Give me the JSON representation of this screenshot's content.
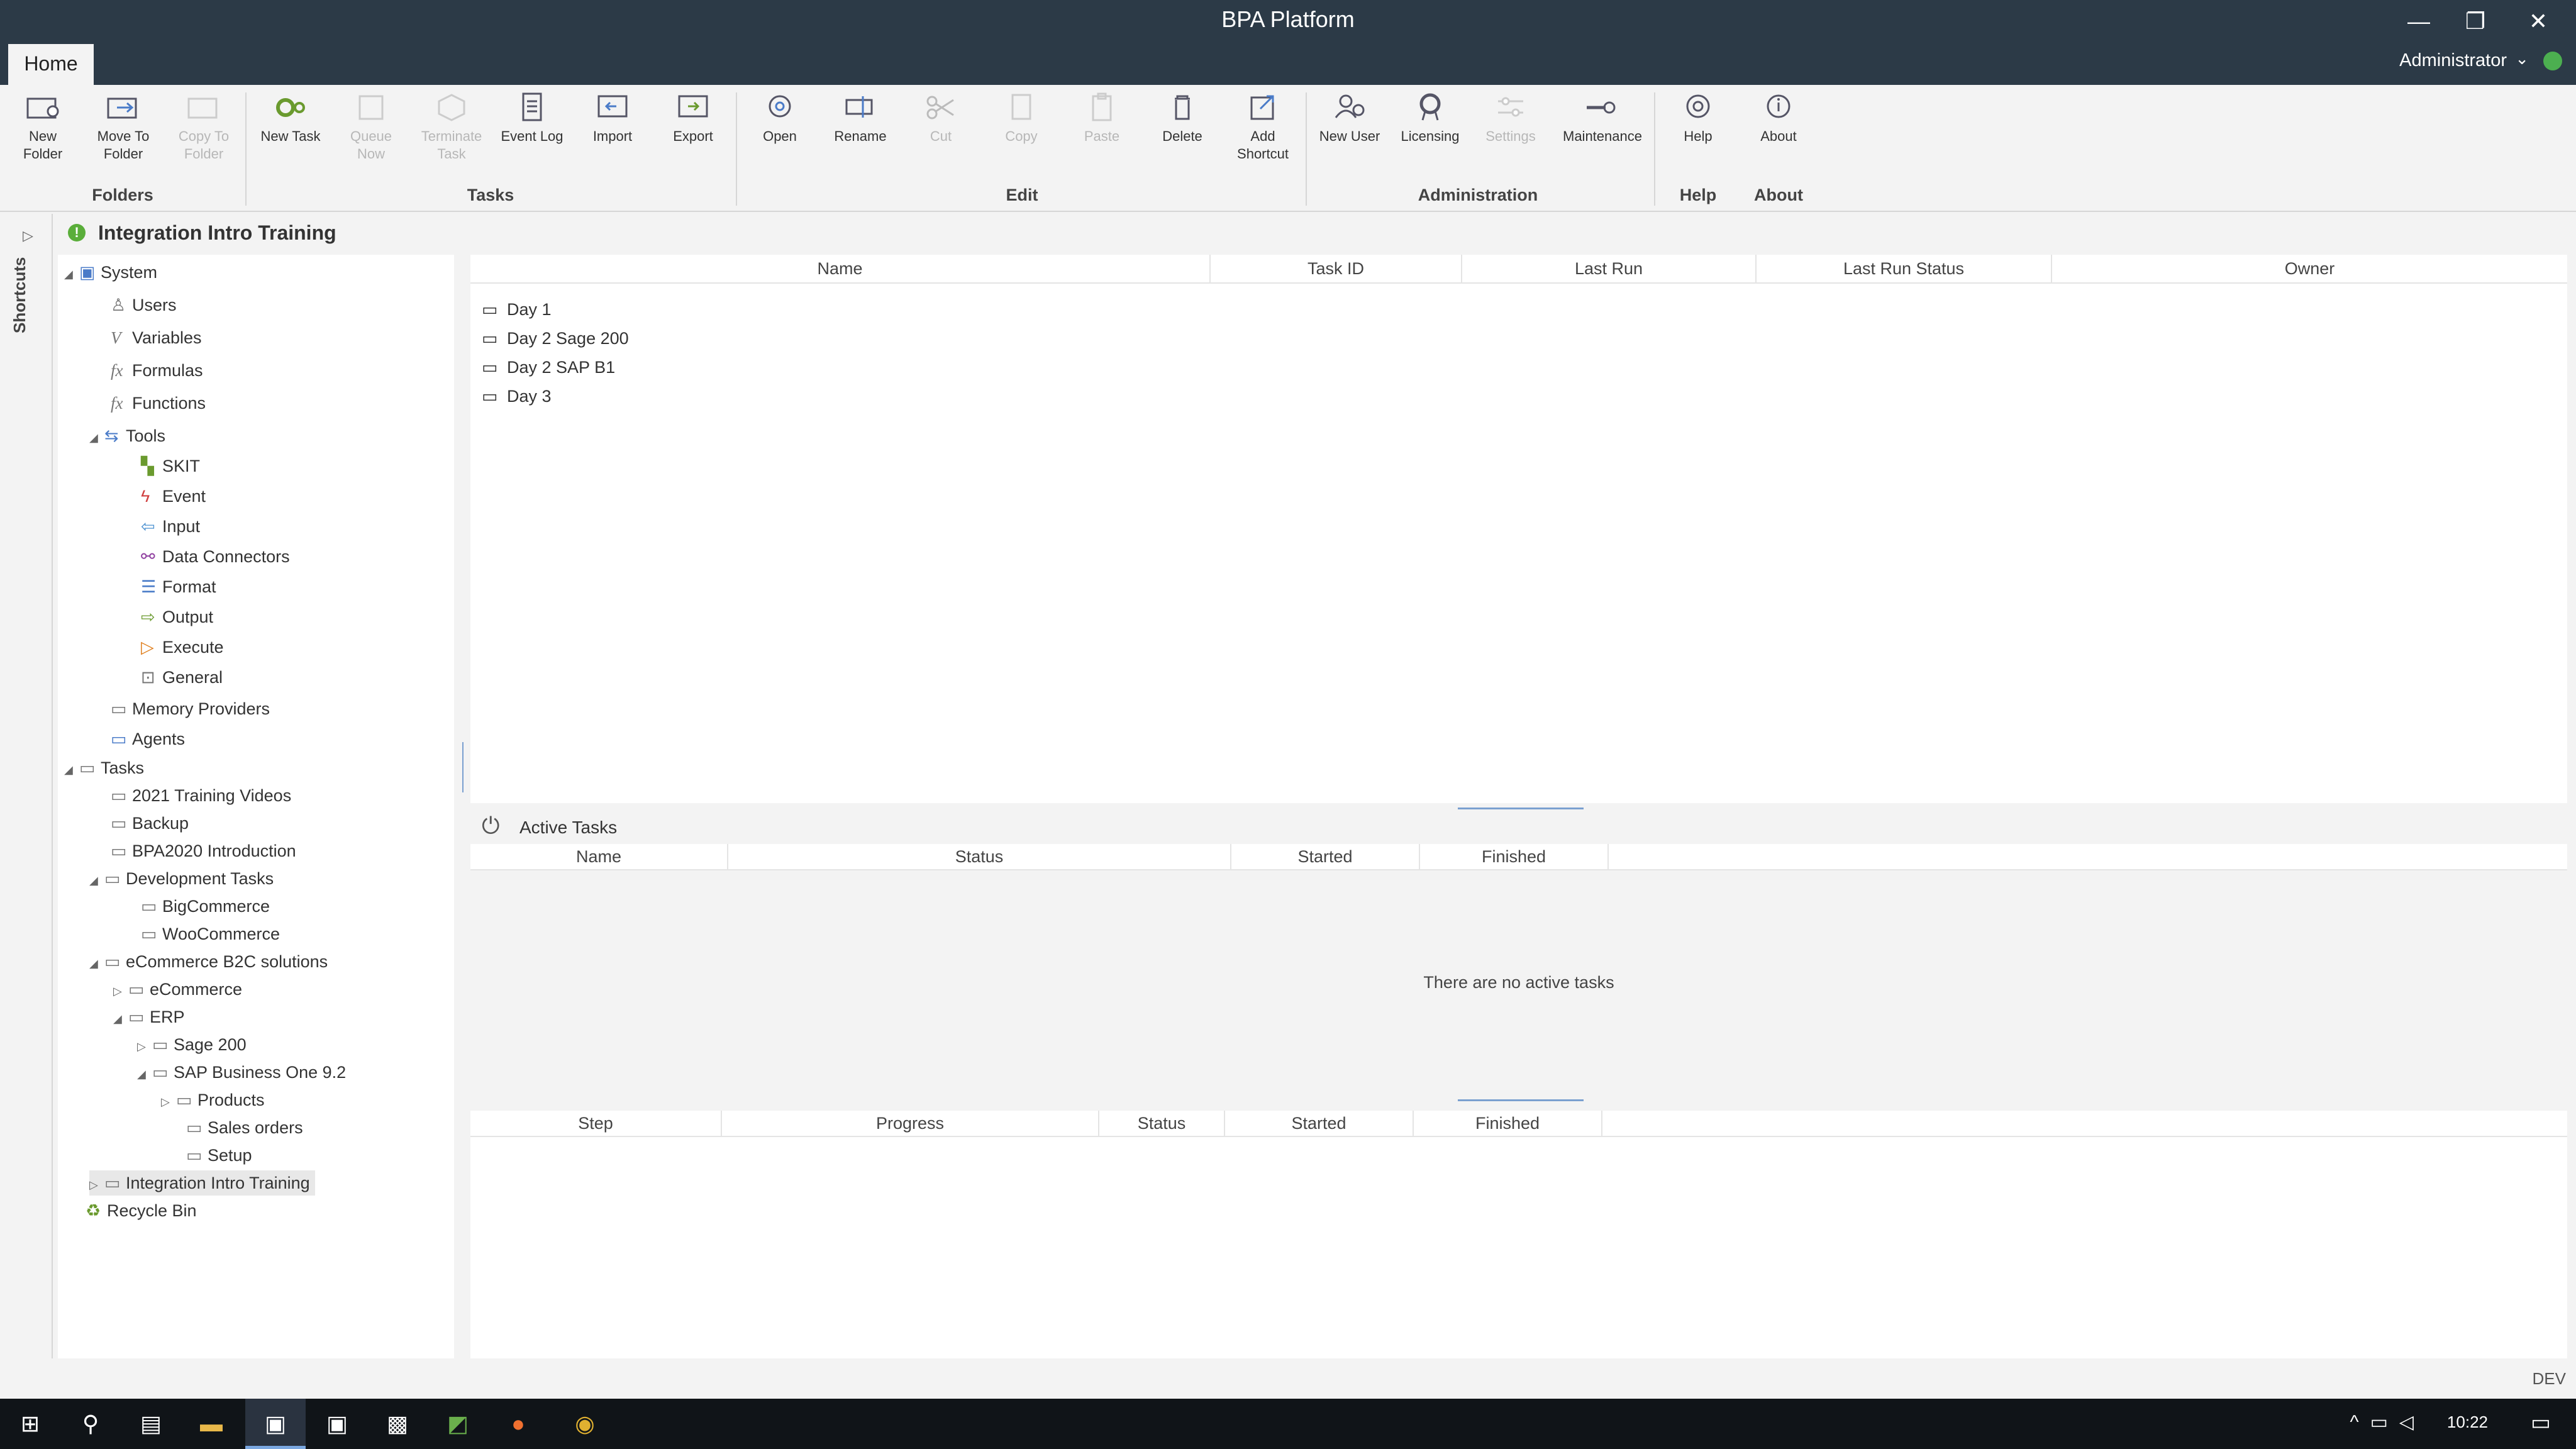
{
  "window": {
    "title": "BPA Platform",
    "minimize": "—",
    "maximize": "❐",
    "close": "✕"
  },
  "ribbon": {
    "tab": "Home",
    "user": "Administrator",
    "groups": {
      "folders": "Folders",
      "tasks": "Tasks",
      "edit": "Edit",
      "administration": "Administration",
      "help": "Help",
      "about": "About"
    },
    "buttons": {
      "new_folder": "New\nFolder",
      "move_to_folder": "Move To\nFolder",
      "copy_to_folder": "Copy To\nFolder",
      "new_task": "New Task",
      "queue_now": "Queue\nNow",
      "terminate_task": "Terminate\nTask",
      "event_log": "Event Log",
      "import": "Import",
      "export": "Export",
      "open": "Open",
      "rename": "Rename",
      "cut": "Cut",
      "copy": "Copy",
      "paste": "Paste",
      "delete": "Delete",
      "add_shortcut": "Add\nShortcut",
      "new_user": "New User",
      "licensing": "Licensing",
      "settings": "Settings",
      "maintenance": "Maintenance",
      "help": "Help",
      "about": "About"
    }
  },
  "shortcuts_label": "Shortcuts",
  "panel_title": "Integration Intro Training",
  "tree": {
    "system": "System",
    "users": "Users",
    "variables": "Variables",
    "formulas": "Formulas",
    "functions": "Functions",
    "tools": "Tools",
    "skit": "SKIT",
    "event": "Event",
    "input": "Input",
    "data_connectors": "Data Connectors",
    "format": "Format",
    "output": "Output",
    "execute": "Execute",
    "general": "General",
    "memory_providers": "Memory Providers",
    "agents": "Agents",
    "tasks": "Tasks",
    "training_videos": "2021 Training Videos",
    "backup": "Backup",
    "bpa2020": "BPA2020 Introduction",
    "development_tasks": "Development Tasks",
    "bigcommerce": "BigCommerce",
    "woocommerce": "WooCommerce",
    "ecommerce_b2c": "eCommerce B2C solutions",
    "ecommerce": "eCommerce",
    "erp": "ERP",
    "sage200": "Sage 200",
    "sap_b1": "SAP Business One 9.2",
    "products": "Products",
    "sales_orders": "Sales orders",
    "setup": "Setup",
    "integration_intro": "Integration Intro Training",
    "recycle_bin": "Recycle Bin"
  },
  "main_grid": {
    "columns": [
      "Name",
      "Task ID",
      "Last Run",
      "Last Run Status",
      "Owner"
    ],
    "rows": [
      "Day 1",
      "Day 2 Sage 200",
      "Day 2 SAP B1",
      "Day 3"
    ]
  },
  "active_tasks": {
    "title": "Active Tasks",
    "columns": [
      "Name",
      "Status",
      "Started",
      "Finished"
    ],
    "empty": "There are no active tasks"
  },
  "steps_grid": {
    "columns": [
      "Step",
      "Progress",
      "Status",
      "Started",
      "Finished"
    ]
  },
  "status": {
    "env": "DEV"
  },
  "taskbar": {
    "time": "10:22"
  }
}
